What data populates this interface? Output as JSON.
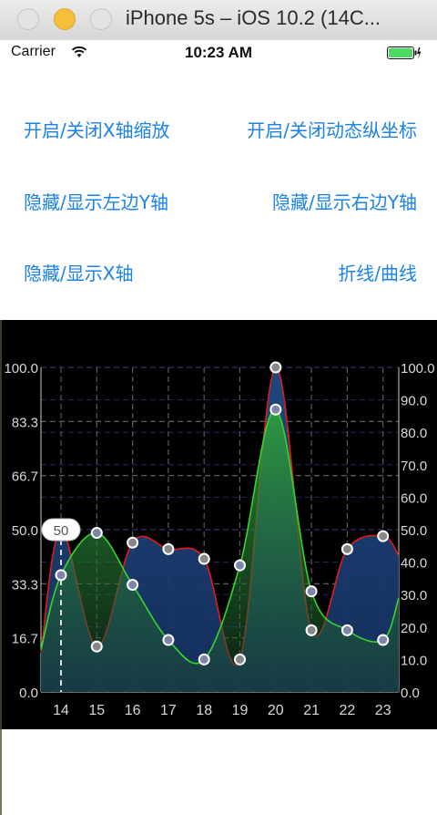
{
  "window": {
    "title": "iPhone 5s – iOS 10.2 (14C..."
  },
  "status_bar": {
    "carrier": "Carrier",
    "time": "10:23 AM"
  },
  "buttons": {
    "toggle_x_zoom": "开启/关闭X轴缩放",
    "toggle_dynamic_y": "开启/关闭动态纵坐标",
    "toggle_left_y": "隐藏/显示左边Y轴",
    "toggle_right_y": "隐藏/显示右边Y轴",
    "toggle_x_axis": "隐藏/显示X轴",
    "line_curve": "折线/曲线"
  },
  "chart_data": {
    "type": "area",
    "categories": [
      "14",
      "15",
      "16",
      "17",
      "18",
      "19",
      "20",
      "21",
      "22",
      "23"
    ],
    "series": [
      {
        "values": [
          50,
          14,
          46,
          44,
          41,
          10,
          100,
          19,
          44,
          48
        ],
        "color": "#e21b1b"
      },
      {
        "values": [
          36,
          49,
          33,
          16,
          10,
          39,
          87,
          31,
          19,
          16
        ],
        "color": "#36d62a"
      }
    ],
    "left_axis_ticks": [
      "100.0",
      "83.3",
      "66.7",
      "50.0",
      "33.3",
      "16.7",
      "0.0"
    ],
    "right_axis_ticks": [
      "100.0",
      "90.0",
      "80.0",
      "70.0",
      "60.0",
      "50.0",
      "40.0",
      "30.0",
      "20.0",
      "10.0",
      "0.0"
    ],
    "ylim": [
      0,
      100
    ],
    "highlight": {
      "category": "14",
      "label": "50"
    },
    "grid": true
  }
}
